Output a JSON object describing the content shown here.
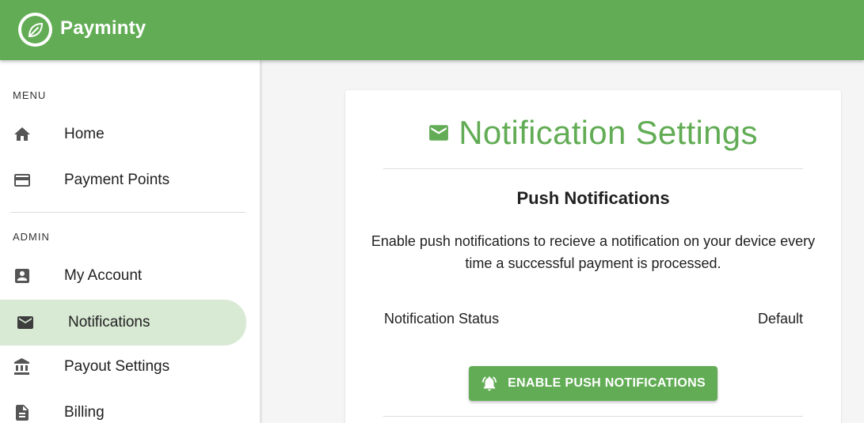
{
  "app": {
    "name": "Payminty",
    "brand_color": "#62ac55"
  },
  "sidebar": {
    "sections": [
      {
        "label": "MENU",
        "items": [
          {
            "label": "Home",
            "icon": "home-icon"
          },
          {
            "label": "Payment Points",
            "icon": "credit-card-icon"
          }
        ]
      },
      {
        "label": "ADMIN",
        "items": [
          {
            "label": "My Account",
            "icon": "account-box-icon"
          },
          {
            "label": "Notifications",
            "icon": "mail-icon",
            "active": true
          },
          {
            "label": "Payout Settings",
            "icon": "bank-icon"
          },
          {
            "label": "Billing",
            "icon": "document-icon"
          }
        ]
      }
    ],
    "active_color": "#d8e9d4"
  },
  "main": {
    "title": "Notification Settings",
    "title_icon": "mail-icon",
    "push": {
      "heading": "Push Notifications",
      "description": "Enable push notifications to recieve a notification on your device every time a successful payment is processed.",
      "status_label": "Notification Status",
      "status_value": "Default",
      "button_label": "ENABLE PUSH NOTIFICATIONS",
      "button_icon": "bell-ring-icon"
    }
  }
}
